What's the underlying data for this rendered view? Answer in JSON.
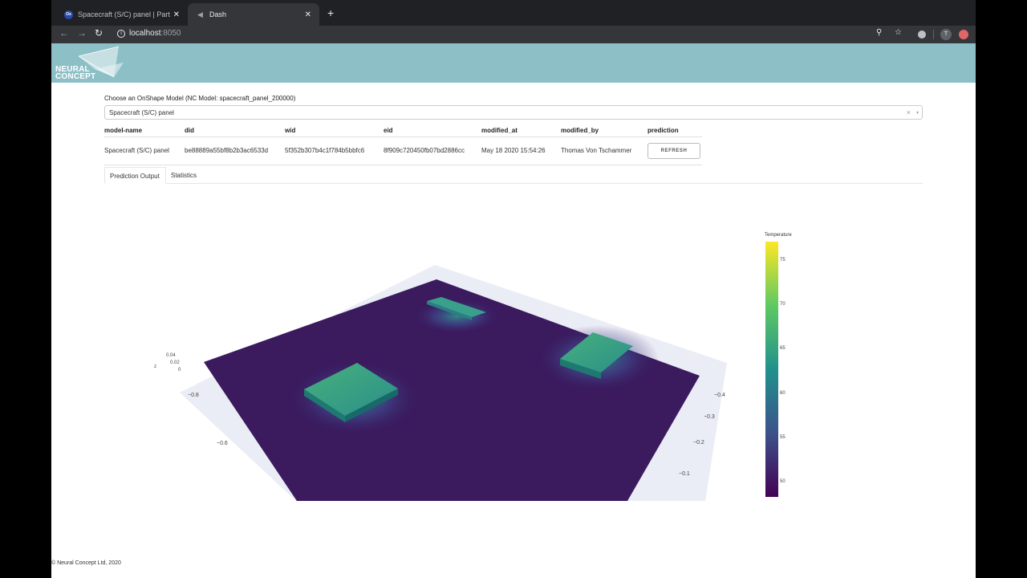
{
  "browser": {
    "tabs": [
      {
        "title": "Spacecraft (S/C) panel | Part S",
        "favicon": "Os"
      },
      {
        "title": "Dash",
        "favicon": "dash-icon"
      }
    ],
    "url_host": "localhost",
    "url_port": ":8050",
    "profile_initial": "T"
  },
  "banner": {
    "logo_line1": "NEURAL",
    "logo_line2": "CONCEPT",
    "color": "#8dbfc6"
  },
  "chooser": {
    "label": "Choose an OnShape Model (NC Model: spacecraft_panel_200000)",
    "value": "Spacecraft (S/C) panel",
    "clear": "×",
    "caret": "▾"
  },
  "model_table": {
    "headers": [
      "model-name",
      "did",
      "wid",
      "eid",
      "modified_at",
      "modified_by",
      "prediction"
    ],
    "row": [
      "Spacecraft (S/C) panel",
      "be88889a55bf8b2b3ac6533d",
      "5f352b307b4c1f784b5bbfc6",
      "8f909c720450fb07bd2886cc",
      "May 18 2020 15:54:26",
      "Thomas Von Tschammer"
    ],
    "refresh_label": "REFRESH"
  },
  "tabs": [
    "Prediction Output",
    "Statistics"
  ],
  "plot": {
    "colorbar": {
      "title": "Temperature",
      "ticks": [
        "75",
        "70",
        "65",
        "60",
        "55",
        "50"
      ],
      "colors": [
        "#440154",
        "#3b528b",
        "#21918c",
        "#5ec962",
        "#fde725"
      ]
    },
    "z_axis": {
      "label": "z",
      "ticks": [
        "0.04",
        "0.02",
        "0"
      ]
    },
    "x_axis": {
      "ticks": [
        "−0.8",
        "−0.6"
      ]
    },
    "y_axis": {
      "ticks": [
        "−0.4",
        "−0.3",
        "−0.2",
        "−0.1"
      ]
    },
    "panel_color": "#3b1a5e"
  },
  "footer": "© Neural Concept Ltd, 2020"
}
